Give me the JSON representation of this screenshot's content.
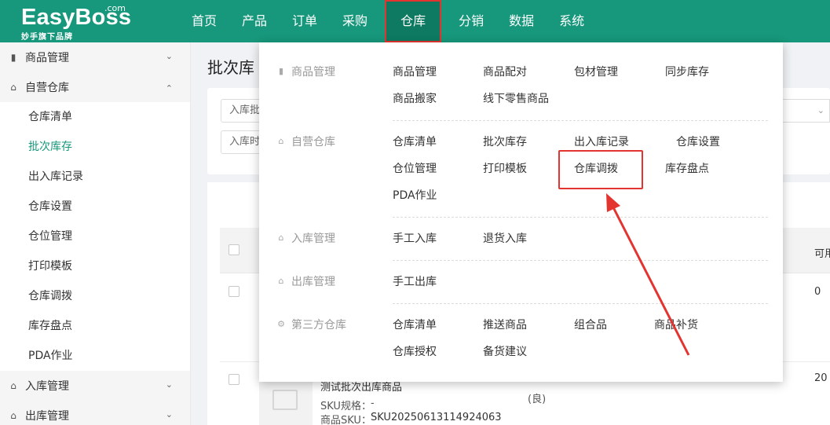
{
  "logo": {
    "brand": "EasyBoss",
    "com": ".com",
    "tagline": "妙手旗下品牌"
  },
  "nav": [
    {
      "label": "首页"
    },
    {
      "label": "产品"
    },
    {
      "label": "订单"
    },
    {
      "label": "采购"
    },
    {
      "label": "仓库"
    },
    {
      "label": "分销"
    },
    {
      "label": "数据"
    },
    {
      "label": "系统"
    }
  ],
  "sidebar": {
    "groups": [
      {
        "label": "商品管理",
        "icon": "clipboard-icon"
      },
      {
        "label": "自营仓库",
        "icon": "warehouse-icon",
        "items": [
          "仓库清单",
          "批次库存",
          "出入库记录",
          "仓库设置",
          "仓位管理",
          "打印模板",
          "仓库调拨",
          "库存盘点",
          "PDA作业"
        ]
      },
      {
        "label": "入库管理",
        "icon": "inbound-icon"
      },
      {
        "label": "出库管理",
        "icon": "outbound-icon"
      }
    ],
    "active_item": "批次库存"
  },
  "main": {
    "page_title": "批次库",
    "filter1_placeholder": "入库批",
    "filter2_placeholder": "入库时",
    "col_available": "可用",
    "row1_available": "0",
    "row2_available": "20",
    "row2_product": "测试批次出库商品",
    "row2_quality": "(良)",
    "row2_spec_label": "SKU规格：",
    "row2_spec_value": "-",
    "row2_sku_label": "商品SKU：",
    "row2_sku_value": "SKU20250613114924063"
  },
  "dropdown": {
    "sections": [
      {
        "category": "商品管理",
        "icon": "clipboard-icon",
        "rows": [
          [
            "商品管理",
            "商品配对",
            "包材管理",
            "同步库存"
          ],
          [
            "商品搬家",
            "线下零售商品"
          ]
        ]
      },
      {
        "category": "自营仓库",
        "icon": "warehouse-icon",
        "rows": [
          [
            "仓库清单",
            "批次库存",
            "出入库记录",
            "仓库设置"
          ],
          [
            "仓位管理",
            "打印模板",
            "仓库调拨",
            "库存盘点"
          ],
          [
            "PDA作业"
          ]
        ]
      },
      {
        "category": "入库管理",
        "icon": "inbound-icon",
        "rows": [
          [
            "手工入库",
            "退货入库"
          ]
        ]
      },
      {
        "category": "出库管理",
        "icon": "outbound-icon",
        "rows": [
          [
            "手工出库"
          ]
        ]
      },
      {
        "category": "第三方仓库",
        "icon": "third-party-icon",
        "rows": [
          [
            "仓库清单",
            "推送商品",
            "组合品",
            "商品补货"
          ],
          [
            "仓库授权",
            "备货建议"
          ]
        ]
      }
    ]
  },
  "colors": {
    "brand": "#17977b",
    "highlight": "#e3342f"
  }
}
